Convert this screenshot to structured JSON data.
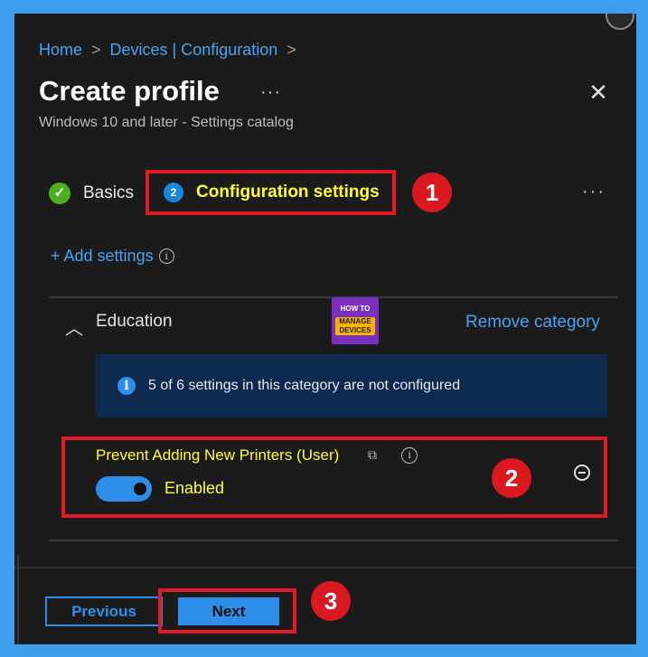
{
  "breadcrumb": {
    "home": "Home",
    "devices": "Devices | Configuration",
    "sep": ">"
  },
  "header": {
    "title": "Create profile",
    "more": "···",
    "close": "✕",
    "subtitle": "Windows 10 and later - Settings catalog"
  },
  "steps": [
    {
      "label": "Basics",
      "status": "completed"
    },
    {
      "number": "2",
      "label": "Configuration settings",
      "status": "current"
    }
  ],
  "tabs_more": "···",
  "add_settings": {
    "label": "+ Add settings",
    "info": "i"
  },
  "category": {
    "name": "Education",
    "remove_label": "Remove category",
    "info_text": "5 of 6 settings in this category are not configured"
  },
  "logo": {
    "line1": "HOW TO",
    "line2": "MANAGE DEVICES"
  },
  "setting": {
    "name": "Prevent Adding New Printers (User)",
    "toggle_label": "Enabled",
    "toggle_on": true
  },
  "callouts": [
    "1",
    "2",
    "3"
  ],
  "footer": {
    "previous": "Previous",
    "next": "Next"
  },
  "colors": {
    "accent": "#2d8fe8",
    "highlight_text": "#ffff33",
    "callout_red": "#d9191f",
    "success": "#4caf1c"
  }
}
